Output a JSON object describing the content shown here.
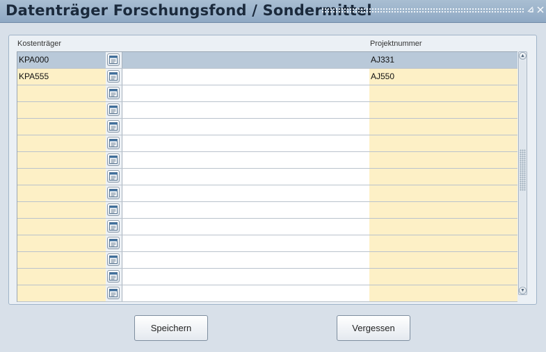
{
  "window": {
    "title": "Datenträger Forschungsfond / Sondermittel",
    "minimize_icon": "minimize-icon",
    "close_icon": "close-icon"
  },
  "table": {
    "headers": {
      "kostentraeger": "Kostenträger",
      "projektnummer": "Projektnummer"
    },
    "lookup_icon": "list-lookup-icon",
    "rows": [
      {
        "kostentraeger": "KPA000",
        "projektnummer": "AJ331",
        "selected": true
      },
      {
        "kostentraeger": "KPA555",
        "projektnummer": "AJ550",
        "selected": false
      },
      {
        "kostentraeger": "",
        "projektnummer": "",
        "selected": false
      },
      {
        "kostentraeger": "",
        "projektnummer": "",
        "selected": false
      },
      {
        "kostentraeger": "",
        "projektnummer": "",
        "selected": false
      },
      {
        "kostentraeger": "",
        "projektnummer": "",
        "selected": false
      },
      {
        "kostentraeger": "",
        "projektnummer": "",
        "selected": false
      },
      {
        "kostentraeger": "",
        "projektnummer": "",
        "selected": false
      },
      {
        "kostentraeger": "",
        "projektnummer": "",
        "selected": false
      },
      {
        "kostentraeger": "",
        "projektnummer": "",
        "selected": false
      },
      {
        "kostentraeger": "",
        "projektnummer": "",
        "selected": false
      },
      {
        "kostentraeger": "",
        "projektnummer": "",
        "selected": false
      },
      {
        "kostentraeger": "",
        "projektnummer": "",
        "selected": false
      },
      {
        "kostentraeger": "",
        "projektnummer": "",
        "selected": false
      },
      {
        "kostentraeger": "",
        "projektnummer": "",
        "selected": false
      }
    ]
  },
  "buttons": {
    "save": "Speichern",
    "discard": "Vergessen"
  },
  "colors": {
    "editable_cell": "#fdf0c6",
    "selected_row": "#b9c9d9",
    "titlebar": "#9cb3cb"
  }
}
